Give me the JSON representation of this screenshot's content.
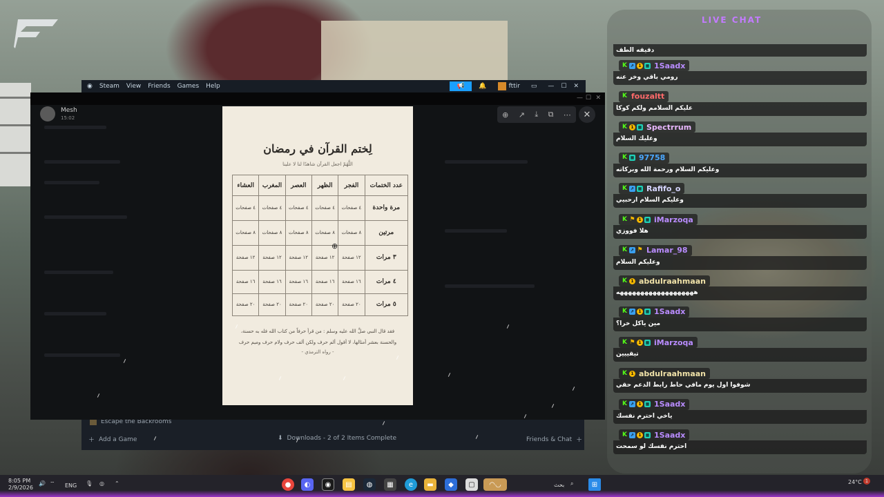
{
  "steam": {
    "menu": [
      "Steam",
      "View",
      "Friends",
      "Games",
      "Help"
    ],
    "account": "fttir",
    "recent_game": "Escape the Backrooms",
    "add_game": "Add a Game",
    "downloads": "Downloads - 2 of 2 Items Complete",
    "friends_chat": "Friends & Chat"
  },
  "viewer": {
    "user_name": "Mesh",
    "time": "15:02"
  },
  "document": {
    "title": "لِختم القرآن في رمضان",
    "subtitle": "اللَّهُمّ اجعل القرآن شاهدًا لنا لا علينا",
    "headers": [
      "عدد الختمات",
      "الفجر",
      "الظهر",
      "العصر",
      "المغرب",
      "العشاء"
    ],
    "rows": [
      {
        "label": "مرة واحدة",
        "cells": [
          "٤ صفحات",
          "٤ صفحات",
          "٤ صفحات",
          "٤ صفحات",
          "٤ صفحات"
        ]
      },
      {
        "label": "مرتين",
        "cells": [
          "٨ صفحات",
          "٨ صفحات",
          "٨ صفحات",
          "٨ صفحات",
          "٨ صفحات"
        ]
      },
      {
        "label": "٣ مرات",
        "cells": [
          "١٢ صفحة",
          "١٢ صفحة",
          "١٢ صفحة",
          "١٢ صفحة",
          "١٢ صفحة"
        ]
      },
      {
        "label": "٤ مرات",
        "cells": [
          "١٦ صفحة",
          "١٦ صفحة",
          "١٦ صفحة",
          "١٦ صفحة",
          "١٦ صفحة"
        ]
      },
      {
        "label": "٥ مرات",
        "cells": [
          "٢٠ صفحة",
          "٢٠ صفحة",
          "٢٠ صفحة",
          "٢٠ صفحة",
          "٢٠ صفحة"
        ]
      }
    ],
    "quote": "فقد قال النبي صلَّ الله عليه وسلم : من قرأ حرفاً من كتاب الله فله به حسنة، والحسنة بعشر أمثالها، لا أقول ألم حرف ولكن ألف حرف ولام حرف وميم حرف",
    "reference": "- رواه الترمذي -"
  },
  "chat": {
    "title": "LIVE CHAT",
    "top_partial": "دقيقه الطف",
    "messages": [
      {
        "user": "1Saadx",
        "color": "#b98cff",
        "badges": [
          "k",
          "b",
          "o",
          "t"
        ],
        "text": "رومي باقي وخر عنه"
      },
      {
        "user": "fouzaltt",
        "color": "#ff6a6a",
        "badges": [
          "k"
        ],
        "text": "عليكم السلامم ولكم كوكا"
      },
      {
        "user": "Spectrrum",
        "color": "#e9b8ff",
        "badges": [
          "k",
          "o",
          "t"
        ],
        "text": "وعليك السلام"
      },
      {
        "user": "97758",
        "color": "#4aa8ff",
        "badges": [
          "k",
          "t"
        ],
        "text": "وعليكم السلام ورحمة الله وبركاته"
      },
      {
        "user": "Rafifo_o",
        "color": "#d6d6ff",
        "badges": [
          "k",
          "b",
          "t"
        ],
        "text": "وعليكم السلام ارحبيي"
      },
      {
        "user": "iMarzoqa",
        "color": "#b98cff",
        "badges": [
          "k",
          "f",
          "o",
          "t"
        ],
        "text": "هلا فووزي"
      },
      {
        "user": "Lamar_98",
        "color": "#b98cff",
        "badges": [
          "k",
          "b",
          "f"
        ],
        "text": "وعليكم السلام"
      },
      {
        "user": "abdulraahmaan",
        "color": "#f0e2a8",
        "badges": [
          "k",
          "o"
        ],
        "text": "هههههههههههههههههههه"
      },
      {
        "user": "1Saadx",
        "color": "#b98cff",
        "badges": [
          "k",
          "b",
          "o",
          "t"
        ],
        "text": "مين ياكل خرا؟"
      },
      {
        "user": "iMarzoqa",
        "color": "#b98cff",
        "badges": [
          "k",
          "f",
          "o",
          "t"
        ],
        "text": "تيقييين"
      },
      {
        "user": "abdulraahmaan",
        "color": "#f0e2a8",
        "badges": [
          "k",
          "o"
        ],
        "text": "شوفوا اول يوم مافي حاط رابط الدعم حقي"
      },
      {
        "user": "1Saadx",
        "color": "#b98cff",
        "badges": [
          "k",
          "b",
          "o",
          "t"
        ],
        "text": "ياخي احترم نفسك"
      },
      {
        "user": "1Saadx",
        "color": "#b98cff",
        "badges": [
          "k",
          "b",
          "o",
          "t"
        ],
        "text": "احترم نفسك لو سمحت"
      }
    ]
  },
  "taskbar": {
    "time": "8:05 PM",
    "date": "2/9/2026",
    "lang": "ENG",
    "search": "بحث",
    "temp": "24°C",
    "notif_count": "1"
  }
}
